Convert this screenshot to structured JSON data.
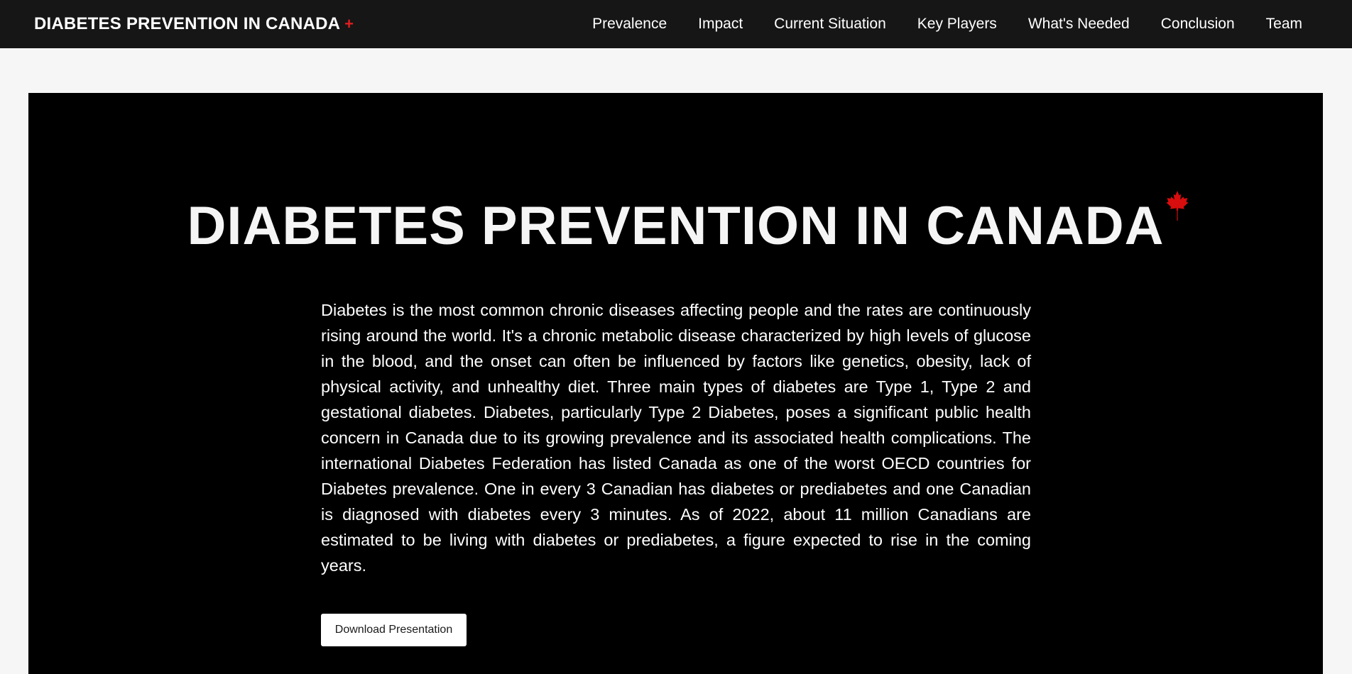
{
  "navbar": {
    "brand": "DIABETES PREVENTION IN CANADA",
    "brand_symbol": "+",
    "links": [
      "Prevalence",
      "Impact",
      "Current Situation",
      "Key Players",
      "What's Needed",
      "Conclusion",
      "Team"
    ]
  },
  "hero": {
    "title": "DIABETES PREVENTION IN CANADA",
    "title_icon": "maple-leaf-icon",
    "paragraph": "Diabetes is the most common chronic diseases affecting people and the rates are continuously rising around the world. It's a chronic metabolic disease characterized by high levels of glucose in the blood, and the onset can often be influenced by factors like genetics, obesity, lack of physical activity, and unhealthy diet. Three main types of diabetes are Type 1, Type 2 and gestational diabetes. Diabetes, particularly Type 2 Diabetes, poses a significant public health concern in Canada due to its growing prevalence and its associated health complications. The international Diabetes Federation has listed Canada as one of the worst OECD countries for Diabetes prevalence. One in every 3 Canadian has diabetes or prediabetes and one Canadian is diagnosed with diabetes every 3 minutes. As of 2022, about 11 million Canadians are estimated to be living with diabetes or prediabetes, a figure expected to rise in the coming years.",
    "download_button": "Download Presentation"
  },
  "colors": {
    "navbar_bg": "#161616",
    "page_bg": "#f6f6f6",
    "hero_bg": "#000000",
    "accent_red": "#e11d1d"
  }
}
